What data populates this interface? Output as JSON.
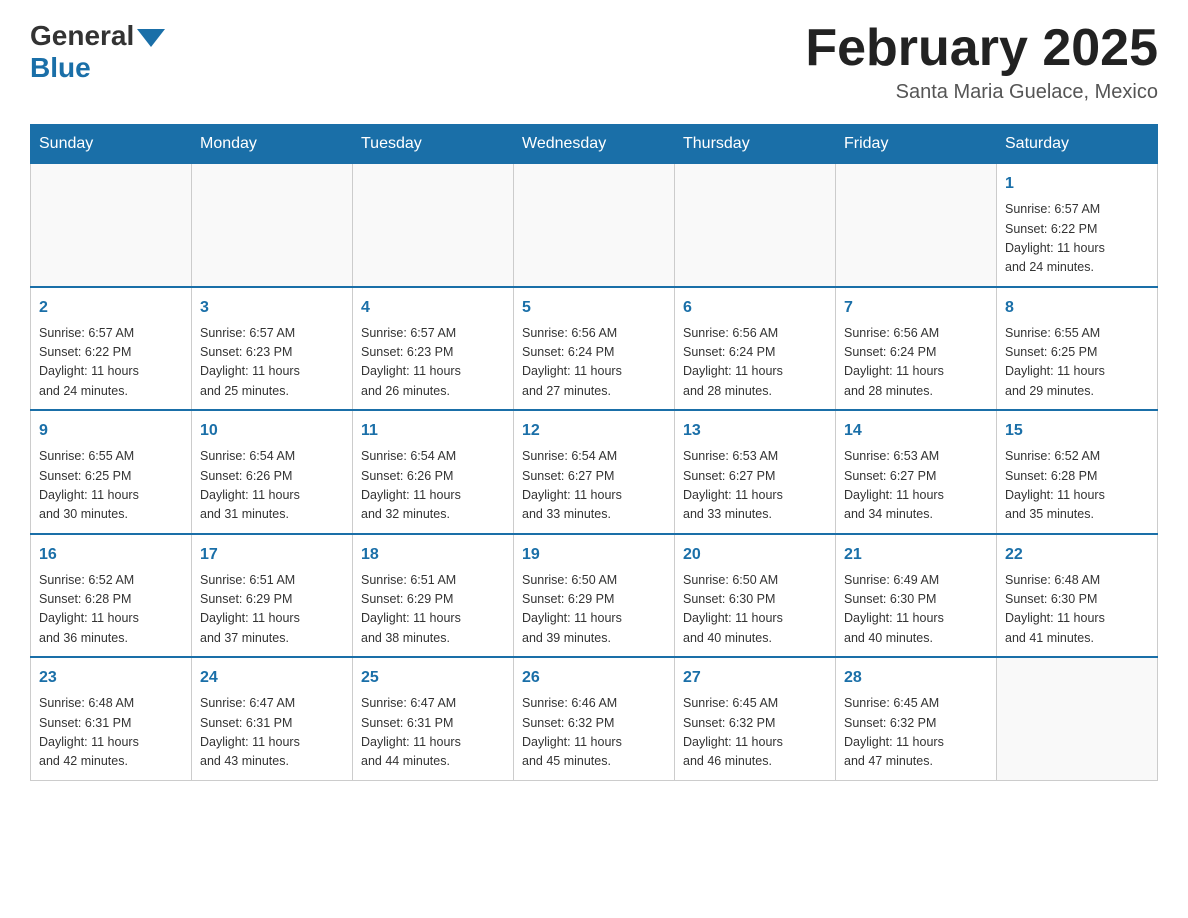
{
  "header": {
    "logo_general": "General",
    "logo_blue": "Blue",
    "month_title": "February 2025",
    "location": "Santa Maria Guelace, Mexico"
  },
  "days_of_week": [
    "Sunday",
    "Monday",
    "Tuesday",
    "Wednesday",
    "Thursday",
    "Friday",
    "Saturday"
  ],
  "weeks": [
    {
      "days": [
        {
          "number": "",
          "info": ""
        },
        {
          "number": "",
          "info": ""
        },
        {
          "number": "",
          "info": ""
        },
        {
          "number": "",
          "info": ""
        },
        {
          "number": "",
          "info": ""
        },
        {
          "number": "",
          "info": ""
        },
        {
          "number": "1",
          "info": "Sunrise: 6:57 AM\nSunset: 6:22 PM\nDaylight: 11 hours\nand 24 minutes."
        }
      ]
    },
    {
      "days": [
        {
          "number": "2",
          "info": "Sunrise: 6:57 AM\nSunset: 6:22 PM\nDaylight: 11 hours\nand 24 minutes."
        },
        {
          "number": "3",
          "info": "Sunrise: 6:57 AM\nSunset: 6:23 PM\nDaylight: 11 hours\nand 25 minutes."
        },
        {
          "number": "4",
          "info": "Sunrise: 6:57 AM\nSunset: 6:23 PM\nDaylight: 11 hours\nand 26 minutes."
        },
        {
          "number": "5",
          "info": "Sunrise: 6:56 AM\nSunset: 6:24 PM\nDaylight: 11 hours\nand 27 minutes."
        },
        {
          "number": "6",
          "info": "Sunrise: 6:56 AM\nSunset: 6:24 PM\nDaylight: 11 hours\nand 28 minutes."
        },
        {
          "number": "7",
          "info": "Sunrise: 6:56 AM\nSunset: 6:24 PM\nDaylight: 11 hours\nand 28 minutes."
        },
        {
          "number": "8",
          "info": "Sunrise: 6:55 AM\nSunset: 6:25 PM\nDaylight: 11 hours\nand 29 minutes."
        }
      ]
    },
    {
      "days": [
        {
          "number": "9",
          "info": "Sunrise: 6:55 AM\nSunset: 6:25 PM\nDaylight: 11 hours\nand 30 minutes."
        },
        {
          "number": "10",
          "info": "Sunrise: 6:54 AM\nSunset: 6:26 PM\nDaylight: 11 hours\nand 31 minutes."
        },
        {
          "number": "11",
          "info": "Sunrise: 6:54 AM\nSunset: 6:26 PM\nDaylight: 11 hours\nand 32 minutes."
        },
        {
          "number": "12",
          "info": "Sunrise: 6:54 AM\nSunset: 6:27 PM\nDaylight: 11 hours\nand 33 minutes."
        },
        {
          "number": "13",
          "info": "Sunrise: 6:53 AM\nSunset: 6:27 PM\nDaylight: 11 hours\nand 33 minutes."
        },
        {
          "number": "14",
          "info": "Sunrise: 6:53 AM\nSunset: 6:27 PM\nDaylight: 11 hours\nand 34 minutes."
        },
        {
          "number": "15",
          "info": "Sunrise: 6:52 AM\nSunset: 6:28 PM\nDaylight: 11 hours\nand 35 minutes."
        }
      ]
    },
    {
      "days": [
        {
          "number": "16",
          "info": "Sunrise: 6:52 AM\nSunset: 6:28 PM\nDaylight: 11 hours\nand 36 minutes."
        },
        {
          "number": "17",
          "info": "Sunrise: 6:51 AM\nSunset: 6:29 PM\nDaylight: 11 hours\nand 37 minutes."
        },
        {
          "number": "18",
          "info": "Sunrise: 6:51 AM\nSunset: 6:29 PM\nDaylight: 11 hours\nand 38 minutes."
        },
        {
          "number": "19",
          "info": "Sunrise: 6:50 AM\nSunset: 6:29 PM\nDaylight: 11 hours\nand 39 minutes."
        },
        {
          "number": "20",
          "info": "Sunrise: 6:50 AM\nSunset: 6:30 PM\nDaylight: 11 hours\nand 40 minutes."
        },
        {
          "number": "21",
          "info": "Sunrise: 6:49 AM\nSunset: 6:30 PM\nDaylight: 11 hours\nand 40 minutes."
        },
        {
          "number": "22",
          "info": "Sunrise: 6:48 AM\nSunset: 6:30 PM\nDaylight: 11 hours\nand 41 minutes."
        }
      ]
    },
    {
      "days": [
        {
          "number": "23",
          "info": "Sunrise: 6:48 AM\nSunset: 6:31 PM\nDaylight: 11 hours\nand 42 minutes."
        },
        {
          "number": "24",
          "info": "Sunrise: 6:47 AM\nSunset: 6:31 PM\nDaylight: 11 hours\nand 43 minutes."
        },
        {
          "number": "25",
          "info": "Sunrise: 6:47 AM\nSunset: 6:31 PM\nDaylight: 11 hours\nand 44 minutes."
        },
        {
          "number": "26",
          "info": "Sunrise: 6:46 AM\nSunset: 6:32 PM\nDaylight: 11 hours\nand 45 minutes."
        },
        {
          "number": "27",
          "info": "Sunrise: 6:45 AM\nSunset: 6:32 PM\nDaylight: 11 hours\nand 46 minutes."
        },
        {
          "number": "28",
          "info": "Sunrise: 6:45 AM\nSunset: 6:32 PM\nDaylight: 11 hours\nand 47 minutes."
        },
        {
          "number": "",
          "info": ""
        }
      ]
    }
  ]
}
